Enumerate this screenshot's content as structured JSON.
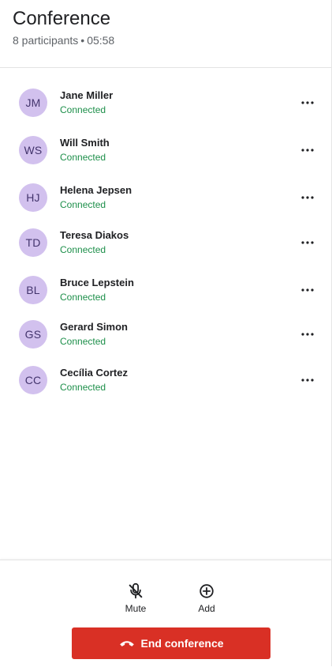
{
  "header": {
    "title": "Conference",
    "participant_count": "8 participants",
    "separator": "•",
    "timer": "05:58"
  },
  "participants": [
    {
      "initials": "JM",
      "name": "Jane Miller",
      "status": "Connected"
    },
    {
      "initials": "WS",
      "name": "Will Smith",
      "status": "Connected"
    },
    {
      "initials": "HJ",
      "name": "Helena Jepsen",
      "status": "Connected"
    },
    {
      "initials": "TD",
      "name": "Teresa Diakos",
      "status": "Connected"
    },
    {
      "initials": "BL",
      "name": "Bruce Lepstein",
      "status": "Connected"
    },
    {
      "initials": "GS",
      "name": "Gerard Simon",
      "status": "Connected"
    },
    {
      "initials": "CC",
      "name": "Cecília Cortez",
      "status": "Connected"
    }
  ],
  "footer": {
    "mute_label": "Mute",
    "add_label": "Add",
    "end_label": "End conference",
    "mute_icon": "mic-off-icon",
    "add_icon": "add-circle-icon",
    "end_icon": "phone-hangup-icon"
  },
  "colors": {
    "avatar_bg": "#d2c1ee",
    "avatar_text": "#43346d",
    "status_green": "#1d8f4a",
    "end_red": "#d93025"
  }
}
